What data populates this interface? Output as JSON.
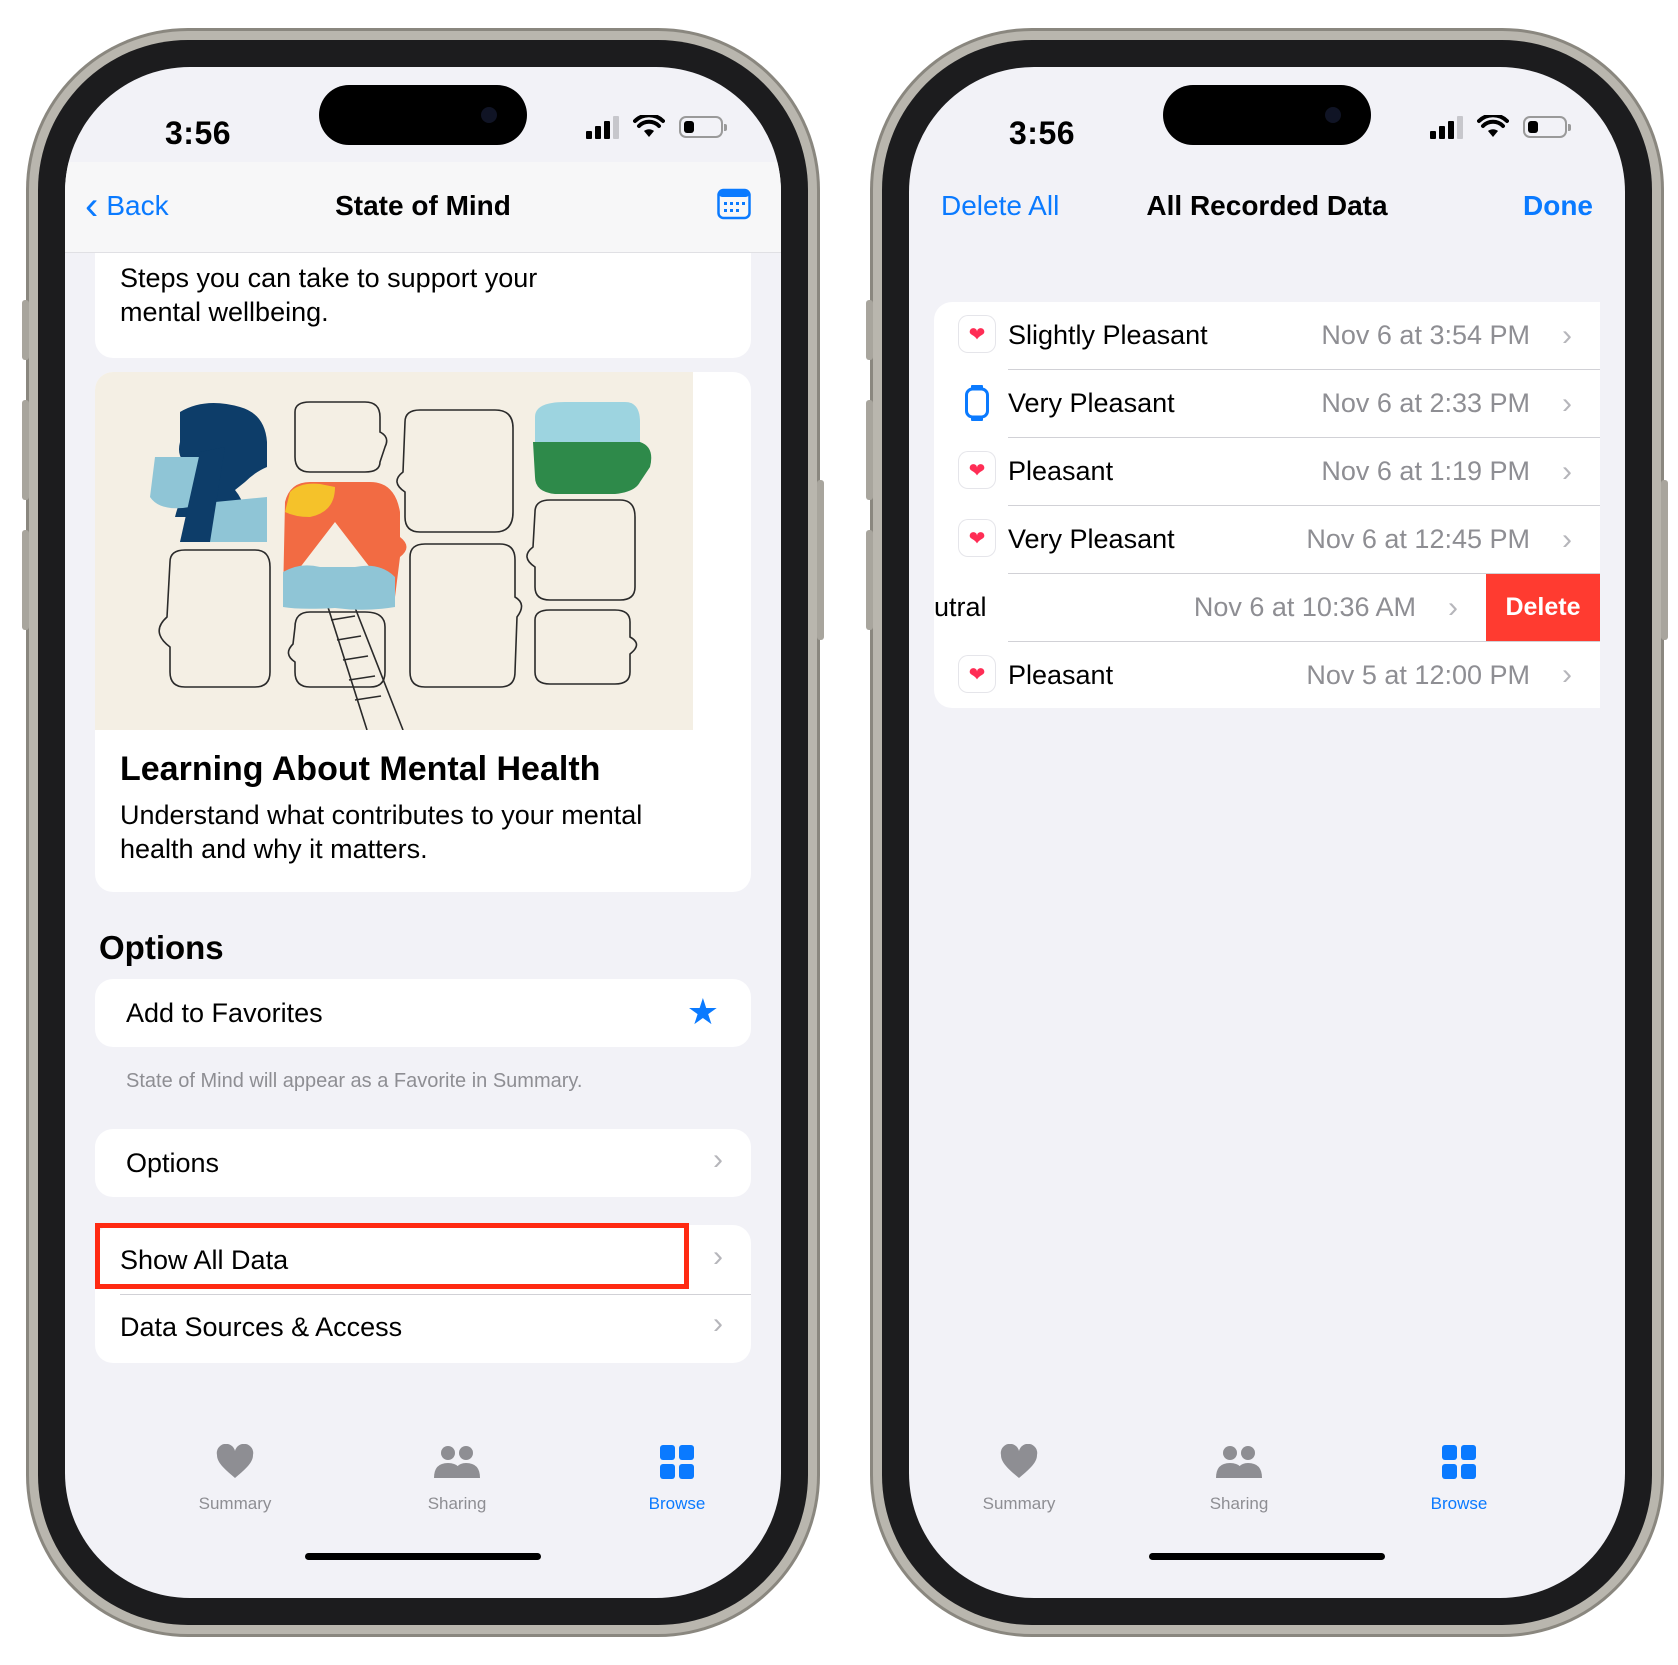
{
  "left": {
    "status": {
      "time": "3:56"
    },
    "nav": {
      "back": "Back",
      "title": "State of Mind"
    },
    "intro": {
      "line1": "Steps you can take to support your",
      "line2": "mental wellbeing."
    },
    "article": {
      "title": "Learning About Mental Health",
      "line1": "Understand what contributes to your mental",
      "line2": "health and why it matters."
    },
    "options_header": "Options",
    "favorites": {
      "label": "Add to Favorites",
      "footnote": "State of Mind will appear as a Favorite in Summary."
    },
    "options_row": "Options",
    "show_all": "Show All Data",
    "sources": "Data Sources & Access",
    "highlight_color": "#ff2a12"
  },
  "right": {
    "status": {
      "time": "3:56"
    },
    "nav": {
      "left": "Delete All",
      "title": "All Recorded Data",
      "right": "Done"
    },
    "rows": [
      {
        "icon": "heart-icon",
        "label": "Slightly Pleasant",
        "time": "Nov 6 at 3:54 PM"
      },
      {
        "icon": "watch-icon",
        "label": "Very Pleasant",
        "time": "Nov 6 at 2:33 PM"
      },
      {
        "icon": "heart-icon",
        "label": "Pleasant",
        "time": "Nov 6 at 1:19 PM"
      },
      {
        "icon": "heart-icon",
        "label": "Very Pleasant",
        "time": "Nov 6 at 12:45 PM"
      },
      {
        "icon": "none",
        "label": "utral",
        "time": "Nov 6 at 10:36 AM",
        "swipe_action": "Delete"
      },
      {
        "icon": "heart-icon",
        "label": "Pleasant",
        "time": "Nov 5 at 12:00 PM"
      }
    ],
    "delete_color": "#ff3b30"
  },
  "tabs": {
    "summary": "Summary",
    "sharing": "Sharing",
    "browse": "Browse"
  },
  "colors": {
    "accent": "#0a7aff",
    "background": "#f2f2f7",
    "heart": "#ff2d55"
  }
}
